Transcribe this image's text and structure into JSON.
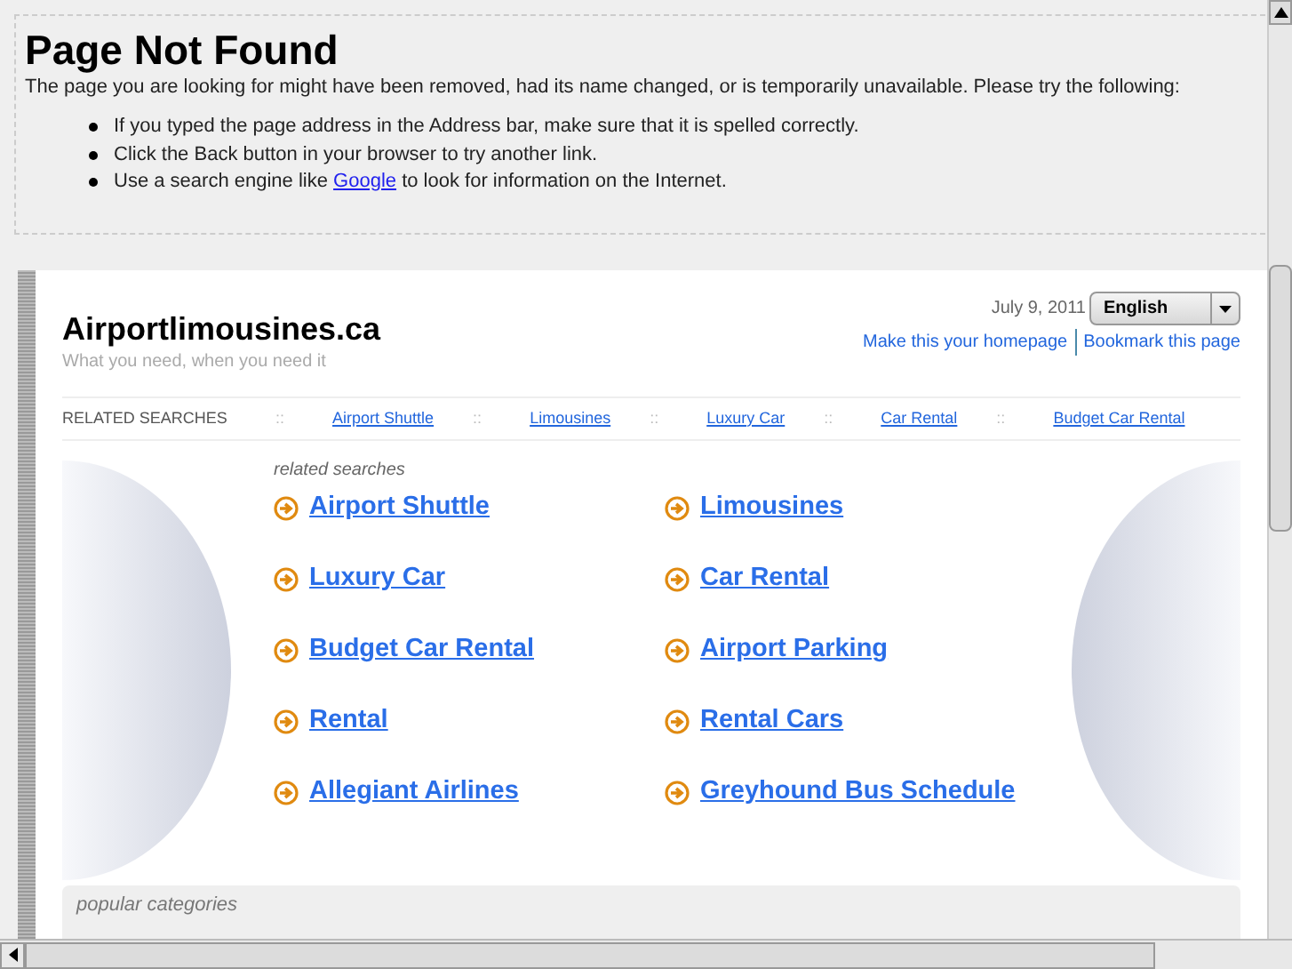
{
  "error": {
    "title": "Page Not Found",
    "message": "The page you are looking for might have been removed, had its name changed, or is temporarily unavailable. Please try the following:",
    "tips": [
      {
        "text": "If you typed the page address in the Address bar, make sure that it is spelled correctly."
      },
      {
        "text": "Click the Back button in your browser to try another link."
      },
      {
        "before": "Use a search engine like",
        "link": "Google",
        "after": "to look for information on the Internet."
      }
    ]
  },
  "site": {
    "name": "Airportlimousines.ca",
    "tagline": "What you need, when you need it",
    "date": "July 9, 2011",
    "language": "English",
    "links": [
      "Make this your homepage",
      "Bookmark this page"
    ]
  },
  "related_bar": {
    "label": "RELATED SEARCHES",
    "separator": "::",
    "links": [
      "Airport Shuttle",
      "Limousines",
      "Luxury Car",
      "Car Rental",
      "Budget Car Rental"
    ]
  },
  "related": {
    "heading": "related searches",
    "links": [
      "Airport Shuttle",
      "Limousines",
      "Luxury Car",
      "Car Rental",
      "Budget Car Rental",
      "Airport Parking",
      "Rental",
      "Rental Cars",
      "Allegiant Airlines",
      "Greyhound Bus Schedule"
    ]
  },
  "popular": {
    "heading": "popular categories"
  }
}
